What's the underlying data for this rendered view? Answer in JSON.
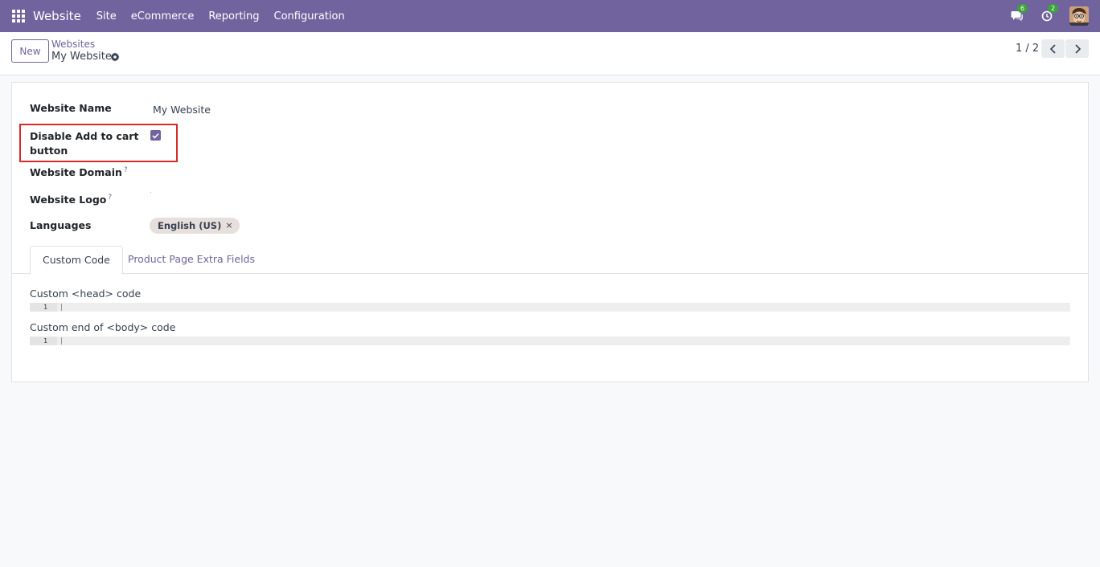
{
  "navbar": {
    "brand": "Website",
    "menu": [
      "Site",
      "eCommerce",
      "Reporting",
      "Configuration"
    ],
    "messages_count": "6",
    "activities_count": "2",
    "accent_color": "#71639e"
  },
  "control_panel": {
    "new_label": "New",
    "breadcrumb_parent": "Websites",
    "breadcrumb_current": "My Website",
    "pager": "1 / 2"
  },
  "form": {
    "website_name_label": "Website Name",
    "website_name_value": "My Website",
    "disable_cart_label_line1": "Disable Add to cart",
    "disable_cart_label_line2": "button",
    "disable_cart_checked": true,
    "website_domain_label": "Website Domain",
    "website_logo_label": "Website Logo",
    "languages_label": "Languages",
    "languages": [
      "English (US)"
    ],
    "help_mark": "?"
  },
  "tabs": {
    "items": [
      "Custom Code",
      "Product Page Extra Fields"
    ],
    "active": "Custom Code"
  },
  "custom_code": {
    "head_label": "Custom <head> code",
    "body_label": "Custom end of <body> code",
    "line_number": "1"
  }
}
